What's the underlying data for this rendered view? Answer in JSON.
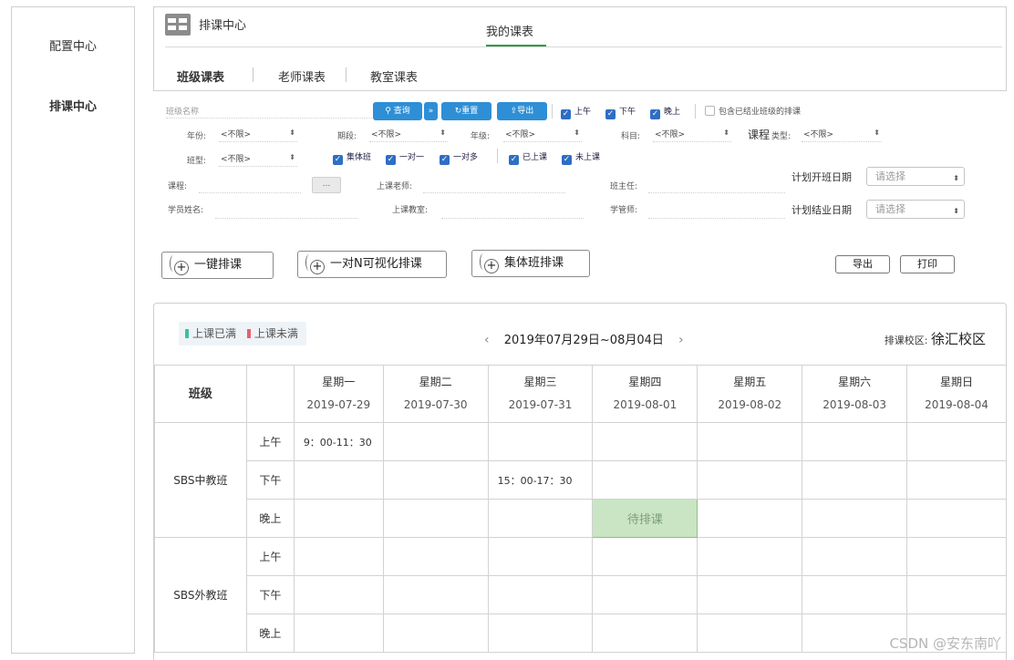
{
  "sidebar": {
    "items": [
      {
        "label": "配置中心"
      },
      {
        "label": "排课中心"
      }
    ]
  },
  "header": {
    "title": "排课中心",
    "top_tab": "我的课表",
    "sub_tabs": [
      {
        "label": "班级课表"
      },
      {
        "label": "老师课表"
      },
      {
        "label": "教室课表"
      }
    ]
  },
  "filters": {
    "class_name_placeholder": "班级名称",
    "query_label": "查询",
    "reset_label": "重置",
    "export_label": "导出",
    "time_checks": [
      {
        "label": "上午",
        "checked": true
      },
      {
        "label": "下午",
        "checked": true
      },
      {
        "label": "晚上",
        "checked": true
      }
    ],
    "include_closed": {
      "label": "包含已结业班级的排课",
      "checked": false
    },
    "year_label": "年份:",
    "year_value": "<不限>",
    "term_label": "期段:",
    "term_value": "<不限>",
    "grade_label": "年级:",
    "grade_value": "<不限>",
    "subject_label": "科目:",
    "subject_value": "<不限>",
    "course_type_prefix": "课程",
    "course_type_label": "类型:",
    "course_type_value": "<不限>",
    "class_type_label": "班型:",
    "class_type_value": "<不限>",
    "type_checks": [
      {
        "label": "集体班",
        "checked": true
      },
      {
        "label": "一对一",
        "checked": true
      },
      {
        "label": "一对多",
        "checked": true
      }
    ],
    "status_checks": [
      {
        "label": "已上课",
        "checked": true
      },
      {
        "label": "未上课",
        "checked": true
      }
    ],
    "course_label": "课程:",
    "course_button": "...",
    "teacher_label": "上课老师:",
    "head_teacher_label": "班主任:",
    "student_label": "学员姓名:",
    "classroom_label": "上课教室:",
    "manager_label": "学管师:",
    "start_date_label": "计划开班日期",
    "start_date_placeholder": "请选择",
    "end_date_label": "计划结业日期",
    "end_date_placeholder": "请选择"
  },
  "actions": {
    "one_click": "一键排课",
    "one_to_n": "一对N可视化排课",
    "group_class": "集体班排课",
    "export": "导出",
    "print": "打印"
  },
  "calendar": {
    "legend": [
      {
        "label": "上课已满",
        "color": "#3cc29a"
      },
      {
        "label": "上课未满",
        "color": "#e8606a"
      }
    ],
    "week_range": "2019年07月29日~08月04日",
    "prev": "‹",
    "next": "›",
    "campus_label": "排课校区:",
    "campus_value": "徐汇校区",
    "class_header": "班级",
    "days": [
      {
        "name": "星期一",
        "date": "2019-07-29"
      },
      {
        "name": "星期二",
        "date": "2019-07-30"
      },
      {
        "name": "星期三",
        "date": "2019-07-31"
      },
      {
        "name": "星期四",
        "date": "2019-08-01"
      },
      {
        "name": "星期五",
        "date": "2019-08-02"
      },
      {
        "name": "星期六",
        "date": "2019-08-03"
      },
      {
        "name": "星期日",
        "date": "2019-08-04"
      }
    ],
    "classes": [
      {
        "name": "SBS中教班",
        "slots": [
          {
            "period": "上午",
            "cells": [
              "9：00-11：30",
              "",
              "",
              "",
              "",
              "",
              ""
            ]
          },
          {
            "period": "下午",
            "cells": [
              "",
              "",
              "15：00-17：30",
              "",
              "",
              "",
              ""
            ]
          },
          {
            "period": "晚上",
            "cells": [
              "",
              "",
              "",
              "待排课",
              "",
              "",
              ""
            ]
          }
        ]
      },
      {
        "name": "SBS外教班",
        "slots": [
          {
            "period": "上午",
            "cells": [
              "",
              "",
              "",
              "",
              "",
              "",
              ""
            ]
          },
          {
            "period": "下午",
            "cells": [
              "",
              "",
              "",
              "",
              "",
              "",
              ""
            ]
          },
          {
            "period": "晚上",
            "cells": [
              "",
              "",
              "",
              "",
              "",
              "",
              ""
            ]
          }
        ]
      }
    ],
    "pending_text": "待排课"
  },
  "watermark": "CSDN @安东南吖"
}
